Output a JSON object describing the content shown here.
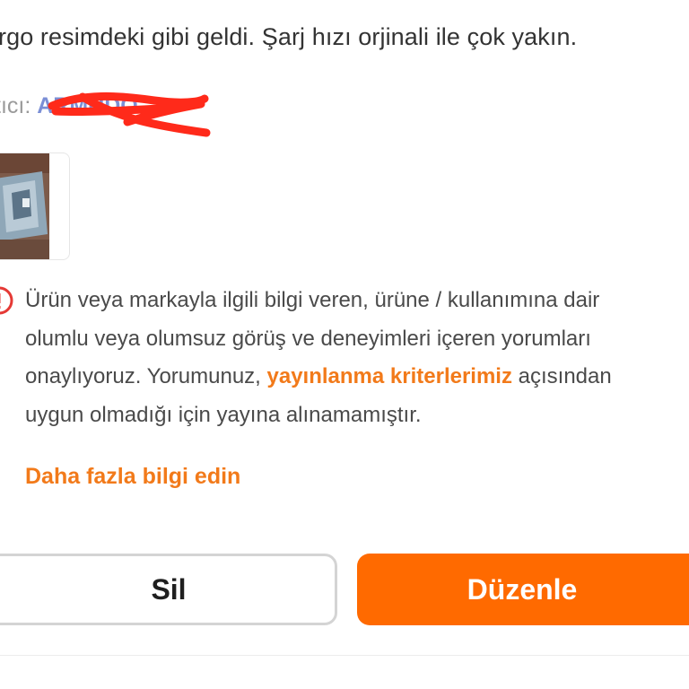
{
  "review": {
    "text": "rgo resimdeki gibi geldi. Şarj hızı orjinali ile çok yakın."
  },
  "seller": {
    "label": "tıcı:",
    "name": "ARMUDO"
  },
  "thumbnail": {
    "icon": "product-photo"
  },
  "notice": {
    "icon": "info-circle-icon",
    "accent_color": "#e53935",
    "line1": "Ürün veya markayla ilgili bilgi veren, ürüne / kullanımına dair",
    "line2": "olumlu veya olumsuz görüş ve deneyimleri içeren yorumları",
    "line3_before": "onaylıyoruz. Yorumunuz, ",
    "line3_link": "yayınlanma kriterlerimiz",
    "line3_after": " açısından",
    "line4": "uygun olmadığı için yayına alınamamıştır."
  },
  "more_info": {
    "label": "Daha fazla bilgi edin"
  },
  "actions": {
    "delete_label": "Sil",
    "edit_label": "Düzenle",
    "primary_color": "#ff6a00",
    "link_color": "#f27a1a"
  }
}
